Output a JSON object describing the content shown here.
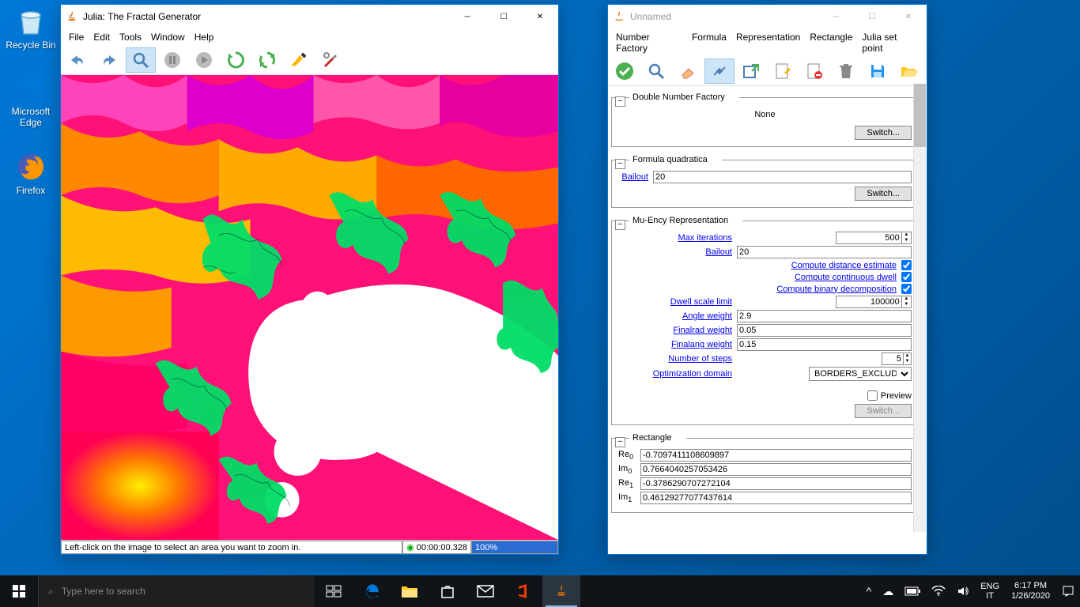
{
  "desktop": {
    "recycle": "Recycle Bin",
    "edge1": "Microsoft",
    "edge2": "Edge",
    "firefox": "Firefox"
  },
  "main_window": {
    "title": "Julia: The Fractal Generator",
    "menu": {
      "file": "File",
      "edit": "Edit",
      "tools": "Tools",
      "window": "Window",
      "help": "Help"
    },
    "status_msg": "Left-click on the image to select an area you want to zoom in.",
    "elapsed": "00:00:00.328",
    "progress": "100%"
  },
  "props_window": {
    "title": "Unnamed",
    "menu": {
      "nf": "Number Factory",
      "formula": "Formula",
      "repr": "Representation",
      "rect": "Rectangle",
      "julia": "Julia set point"
    },
    "double_factory": {
      "legend": "Double Number Factory",
      "value": "None",
      "switch": "Switch..."
    },
    "formula": {
      "legend": "Formula quadratica",
      "bailout_label": "Bailout",
      "bailout": "20",
      "switch": "Switch..."
    },
    "muency": {
      "legend": "Mu-Ency Representation",
      "max_iter_label": "Max iterations",
      "max_iter": "500",
      "bailout_label": "Bailout",
      "bailout": "20",
      "dist_label": "Compute distance estimate",
      "cont_label": "Compute continuous dwell",
      "bin_label": "Compute binary decomposition",
      "dwell_label": "Dwell scale limit",
      "dwell": "100000",
      "angle_label": "Angle weight",
      "angle": "2.9",
      "finalrad_label": "Finalrad weight",
      "finalrad": "0.05",
      "finalang_label": "Finalang weight",
      "finalang": "0.15",
      "steps_label": "Number of steps",
      "steps": "5",
      "opt_label": "Optimization domain",
      "opt": "BORDERS_EXCLUDED",
      "preview": "Preview",
      "switch": "Switch..."
    },
    "rect": {
      "legend": "Rectangle",
      "re0": "-0.7097411108609897",
      "im0": "0.7664040257053426",
      "re1": "-0.3786290707272104",
      "im1": "0.46129277077437614"
    }
  },
  "taskbar": {
    "search_placeholder": "Type here to search",
    "lang1": "ENG",
    "lang2": "IT",
    "time": "6:17 PM",
    "date": "1/26/2020"
  }
}
